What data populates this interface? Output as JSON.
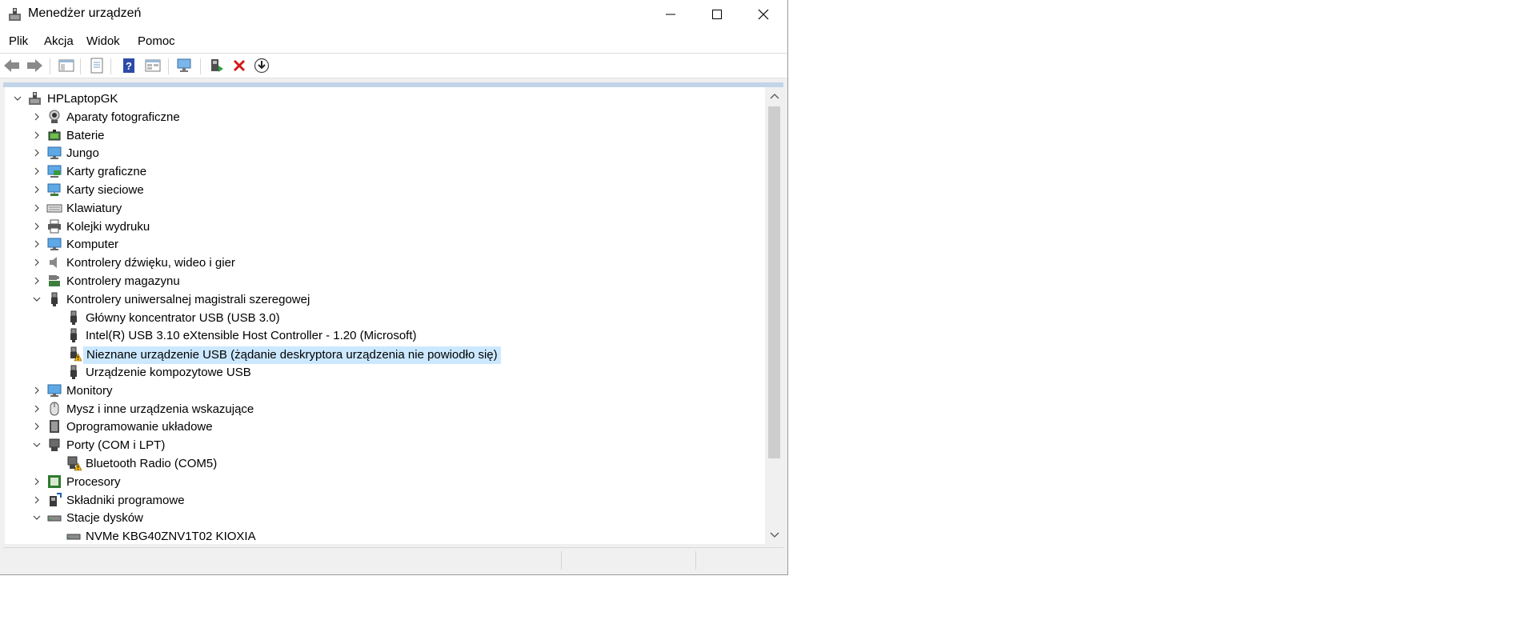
{
  "window": {
    "title": "Menedżer urządzeń"
  },
  "menu": [
    {
      "label": "Plik"
    },
    {
      "label": "Akcja"
    },
    {
      "label": "Widok"
    },
    {
      "label": "Pomoc"
    }
  ],
  "toolbar": {
    "buttons": [
      {
        "name": "back-icon"
      },
      {
        "name": "forward-icon"
      },
      {
        "name": "show-hide-console-tree-icon"
      },
      {
        "name": "properties-icon"
      },
      {
        "name": "help-icon"
      },
      {
        "name": "view-icon"
      },
      {
        "name": "scan-hardware-icon"
      },
      {
        "name": "update-driver-icon"
      },
      {
        "name": "uninstall-device-icon"
      },
      {
        "name": "download-icon"
      }
    ]
  },
  "tree": {
    "root": "HPLaptopGK",
    "items": [
      {
        "label": "Aparaty fotograficzne",
        "icon": "camera-icon"
      },
      {
        "label": "Baterie",
        "icon": "battery-icon"
      },
      {
        "label": "Jungo",
        "icon": "monitor-icon"
      },
      {
        "label": "Karty graficzne",
        "icon": "display-adapter-icon"
      },
      {
        "label": "Karty sieciowe",
        "icon": "network-adapter-icon"
      },
      {
        "label": "Klawiatury",
        "icon": "keyboard-icon"
      },
      {
        "label": "Kolejki wydruku",
        "icon": "printer-icon"
      },
      {
        "label": "Komputer",
        "icon": "computer-icon"
      },
      {
        "label": "Kontrolery dźwięku, wideo i gier",
        "icon": "speaker-icon"
      },
      {
        "label": "Kontrolery magazynu",
        "icon": "storage-controller-icon"
      },
      {
        "label": "Kontrolery uniwersalnej magistrali szeregowej",
        "icon": "usb-icon",
        "expanded": true,
        "children": [
          {
            "label": "Główny koncentrator USB (USB 3.0)",
            "icon": "usb-icon"
          },
          {
            "label": "Intel(R) USB 3.10 eXtensible Host Controller - 1.20 (Microsoft)",
            "icon": "usb-icon"
          },
          {
            "label": "Nieznane urządzenie USB (żądanie deskryptora urządzenia nie powiodło się)",
            "icon": "usb-warning-icon",
            "selected": true
          },
          {
            "label": "Urządzenie kompozytowe USB",
            "icon": "usb-icon"
          }
        ]
      },
      {
        "label": "Monitory",
        "icon": "monitor-icon"
      },
      {
        "label": "Mysz i inne urządzenia wskazujące",
        "icon": "mouse-icon"
      },
      {
        "label": "Oprogramowanie układowe",
        "icon": "firmware-icon"
      },
      {
        "label": "Porty (COM i LPT)",
        "icon": "port-icon",
        "expanded": true,
        "children": [
          {
            "label": "Bluetooth Radio (COM5)",
            "icon": "port-warning-icon"
          }
        ]
      },
      {
        "label": "Procesory",
        "icon": "processor-icon"
      },
      {
        "label": "Składniki programowe",
        "icon": "software-component-icon"
      },
      {
        "label": "Stacje dysków",
        "icon": "disk-drive-icon",
        "expanded": true,
        "children": [
          {
            "label": "NVMe KBG40ZNV1T02 KIOXIA",
            "icon": "disk-drive-icon"
          }
        ]
      }
    ]
  },
  "colors": {
    "selection": "#cce8ff",
    "accent": "#1e5fb5",
    "warning": "#f2b400"
  }
}
